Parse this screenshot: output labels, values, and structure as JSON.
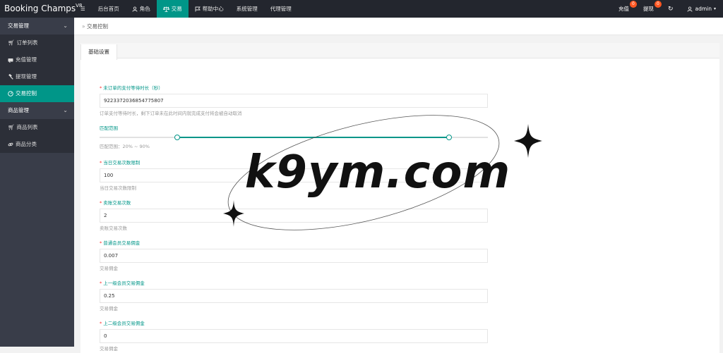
{
  "brand": {
    "name": "Booking Champs",
    "version": "V8"
  },
  "topnav": {
    "menu_icon": "menu-icon",
    "items": [
      {
        "label": "后台首页",
        "icon": ""
      },
      {
        "label": "角色",
        "icon": "user-icon"
      },
      {
        "label": "交易",
        "icon": "scale-icon",
        "active": true
      },
      {
        "label": "帮助中心",
        "icon": "flag-icon"
      },
      {
        "label": "系统管理",
        "icon": ""
      },
      {
        "label": "代理管理",
        "icon": ""
      }
    ],
    "right": {
      "recharge_label": "充值",
      "recharge_badge": "0",
      "withdraw_label": "提现",
      "withdraw_badge": "0",
      "refresh_icon": "refresh-icon",
      "user_label": "admin"
    }
  },
  "sidebar": {
    "groups": [
      {
        "label": "交易管理",
        "items": [
          {
            "label": "订单列表",
            "icon": "cart-icon"
          },
          {
            "label": "充值管理",
            "icon": "card-icon"
          },
          {
            "label": "提现管理",
            "icon": "gavel-icon"
          },
          {
            "label": "交易控制",
            "icon": "gauge-icon",
            "active": true
          }
        ]
      },
      {
        "label": "商品管理",
        "items": [
          {
            "label": "商品列表",
            "icon": "cart-icon"
          },
          {
            "label": "商品分类",
            "icon": "link-icon"
          }
        ]
      }
    ]
  },
  "breadcrumb": {
    "separator": "»",
    "text": "交易控制"
  },
  "tabs": [
    {
      "label": "基础设置"
    }
  ],
  "form": {
    "f1": {
      "label": "未订单的支付等待时长（秒）",
      "value": "9223372036854775807",
      "hint": "订单支付等待时长，剩下订单未在此时间内就完成支付将会被自动取消"
    },
    "range": {
      "label": "匹配范围",
      "hint": "匹配范围：20% ~ 90%",
      "min": 20,
      "max": 90
    },
    "f2": {
      "label": "当日交易次数限制",
      "value": "100",
      "hint": "当日交易次数限制"
    },
    "f3": {
      "label": "卖账交易次数",
      "value": "2",
      "hint": "卖账交易次数"
    },
    "f4": {
      "label": "普通会员交易佣金",
      "value": "0.007",
      "hint": "交易佣金"
    },
    "f5": {
      "label": "上一级会员交易佣金",
      "value": "0.25",
      "hint": "交易佣金"
    },
    "f6": {
      "label": "上二级会员交易佣金",
      "value": "0",
      "hint": "交易佣金"
    }
  },
  "watermark": {
    "text": "k9ym.com"
  },
  "colors": {
    "accent": "#009688",
    "topbar": "#23262e",
    "sidebar": "#393d49",
    "badge": "#ff5722"
  }
}
